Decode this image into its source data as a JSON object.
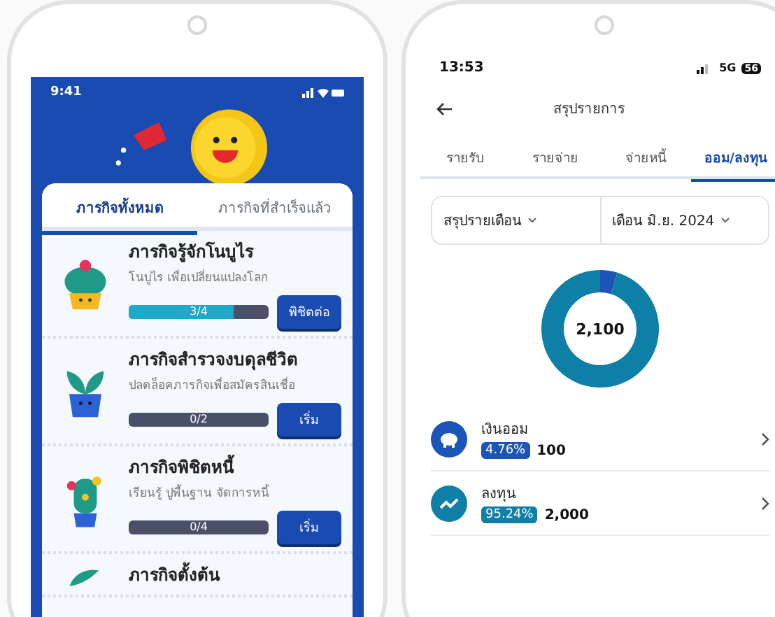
{
  "left_phone": {
    "status_bar": {
      "time": "9:41"
    },
    "tabs": [
      {
        "label": "ภารกิจทั้งหมด",
        "selected": true
      },
      {
        "label": "ภารกิจที่สำเร็จแล้ว",
        "selected": false
      }
    ],
    "missions": [
      {
        "kind": "cactus",
        "title": "ภารกิจรู้จักโนบูไร",
        "subtitle": "โนบูไร เพื่อเปลี่ยนแปลงโลก",
        "level": 0.75,
        "progress": "3/4",
        "button": "พิชิตต่อ"
      },
      {
        "kind": "sprout",
        "title": "ภารกิจสำรวจงบดุลชีวิต",
        "subtitle": "ปลดล็อคภารกิจเพื่อสมัครสินเชื่อ",
        "level": 0,
        "progress": "0/2",
        "button": "เริ่ม"
      },
      {
        "kind": "flower",
        "title": "ภารกิจพิชิตหนี้",
        "subtitle": "เรียนรู้ ปูพื้นฐาน จัดการหนี้",
        "level": 0,
        "progress": "0/4",
        "button": "เริ่ม"
      },
      {
        "kind": "leaf",
        "title": "ภารกิจตั้งต้น"
      }
    ]
  },
  "right_phone": {
    "status_bar": {
      "time": "13:53",
      "network": "5G",
      "battery": "56"
    },
    "header": {
      "title": "สรุปรายการ"
    },
    "tabs": [
      {
        "label": "รายรับ",
        "selected": false
      },
      {
        "label": "รายจ่าย",
        "selected": false
      },
      {
        "label": "จ่ายหนี้",
        "selected": false
      },
      {
        "label": "ออม/ลงทุน",
        "selected": true
      }
    ],
    "filters": [
      {
        "label": "สรุปรายเดือน"
      },
      {
        "label": "เดือน มิ.ย. 2024"
      }
    ],
    "chart_data": {
      "type": "donut",
      "categories": [
        "เงินออม",
        "ลงทุน"
      ],
      "values": [
        4.76,
        95.24
      ],
      "colors": [
        "#1b55b8",
        "#0e7fa6"
      ]
    },
    "total": "2,100",
    "items": [
      {
        "kind": "savings",
        "percent": "4.76%",
        "amount": "100",
        "color": "#1b55b8"
      },
      {
        "kind": "invest",
        "percent": "95.24%",
        "amount": "2,000",
        "color": "#0e7fa6"
      }
    ]
  }
}
